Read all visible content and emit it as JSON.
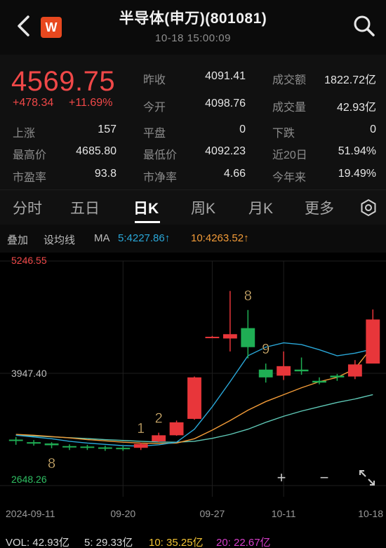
{
  "header": {
    "title": "半导体(申万)(801081)",
    "subtitle": "10-18 15:00:09",
    "logo_text": "W",
    "back_icon": "back-chevron-icon",
    "search_icon": "search-icon"
  },
  "quote": {
    "price": "4569.75",
    "change": "+478.34",
    "change_pct": "+11.69%",
    "rows": [
      [
        {
          "l": "昨收",
          "v": "4091.41"
        },
        {
          "l": "成交额",
          "v": "1822.72亿"
        }
      ],
      [
        {
          "l": "今开",
          "v": "4098.76"
        },
        {
          "l": "成交量",
          "v": "42.93亿"
        }
      ]
    ],
    "grid": [
      [
        {
          "l": "上涨",
          "v": "157"
        },
        {
          "l": "平盘",
          "v": "0"
        },
        {
          "l": "下跌",
          "v": "0"
        }
      ],
      [
        {
          "l": "最高价",
          "v": "4685.80"
        },
        {
          "l": "最低价",
          "v": "4092.23"
        },
        {
          "l": "近20日",
          "v": "51.94%"
        }
      ],
      [
        {
          "l": "市盈率",
          "v": "93.8"
        },
        {
          "l": "市净率",
          "v": "4.66"
        },
        {
          "l": "今年来",
          "v": "19.49%"
        }
      ]
    ]
  },
  "tabs": [
    "分时",
    "五日",
    "日K",
    "周K",
    "月K",
    "更多"
  ],
  "active_tab": "日K",
  "indicators": {
    "overlay": "叠加",
    "ma_setting": "设均线",
    "ma": "MA",
    "ma5": "5:4227.86↑",
    "ma10": "10:4263.52↑"
  },
  "colors": {
    "up": "#e8363a",
    "down": "#1fae54",
    "ma5": "#2aa7d8",
    "ma10": "#f29b38",
    "ma20": "#5fc9b7",
    "ma20_vol": "#d63ec9"
  },
  "chart_data": {
    "type": "candlestick",
    "y_max_label": "5246.55",
    "y_mid_label": "3947.40",
    "y_min_label": "2648.26",
    "ylim": [
      2648.26,
      5246.55
    ],
    "x_ticks": [
      {
        "label": "2024-09-11",
        "index": 0
      },
      {
        "label": "09-20",
        "index": 6
      },
      {
        "label": "09-27",
        "index": 11
      },
      {
        "label": "10-11",
        "index": 15
      },
      {
        "label": "10-18",
        "index": 20
      }
    ],
    "candles": [
      {
        "o": 3180,
        "c": 3165,
        "h": 3210,
        "l": 3120
      },
      {
        "o": 3150,
        "c": 3140,
        "h": 3175,
        "l": 3110
      },
      {
        "o": 3135,
        "c": 3115,
        "h": 3150,
        "l": 3080
      },
      {
        "o": 3105,
        "c": 3100,
        "h": 3125,
        "l": 3060
      },
      {
        "o": 3100,
        "c": 3095,
        "h": 3120,
        "l": 3060
      },
      {
        "o": 3090,
        "c": 3085,
        "h": 3110,
        "l": 3050
      },
      {
        "o": 3085,
        "c": 3080,
        "h": 3105,
        "l": 3050
      },
      {
        "o": 3085,
        "c": 3130,
        "h": 3145,
        "l": 3060
      },
      {
        "o": 3160,
        "c": 3230,
        "h": 3260,
        "l": 3150
      },
      {
        "o": 3230,
        "c": 3380,
        "h": 3400,
        "l": 3225
      },
      {
        "o": 3420,
        "c": 3900,
        "h": 3910,
        "l": 3410
      },
      {
        "o": 4370,
        "c": 4370,
        "h": 4380,
        "l": 4360
      },
      {
        "o": 4350,
        "c": 4400,
        "h": 4900,
        "l": 4200
      },
      {
        "o": 4470,
        "c": 4250,
        "h": 4680,
        "l": 4120
      },
      {
        "o": 3990,
        "c": 3900,
        "h": 4060,
        "l": 3840
      },
      {
        "o": 3920,
        "c": 4030,
        "h": 4200,
        "l": 3870
      },
      {
        "o": 3990,
        "c": 3970,
        "h": 4130,
        "l": 3930
      },
      {
        "o": 3860,
        "c": 3840,
        "h": 3900,
        "l": 3820
      },
      {
        "o": 3920,
        "c": 3900,
        "h": 3940,
        "l": 3860
      },
      {
        "o": 3910,
        "c": 4050,
        "h": 4100,
        "l": 3880
      },
      {
        "o": 4060,
        "c": 4570,
        "h": 4685.8,
        "l": 4092.23
      }
    ],
    "ma5": [
      3230,
      3210,
      3190,
      3160,
      3140,
      3125,
      3110,
      3105,
      3120,
      3150,
      3300,
      3560,
      3850,
      4150,
      4250,
      4300,
      4280,
      4220,
      4150,
      4180,
      4227.86
    ],
    "ma10": [
      3240,
      3230,
      3215,
      3200,
      3180,
      3165,
      3150,
      3140,
      3135,
      3140,
      3190,
      3290,
      3400,
      3520,
      3620,
      3700,
      3780,
      3850,
      3900,
      4000,
      4263.52
    ],
    "ma20": [
      3230,
      3222,
      3212,
      3202,
      3192,
      3180,
      3170,
      3160,
      3152,
      3150,
      3160,
      3195,
      3240,
      3300,
      3380,
      3450,
      3510,
      3560,
      3610,
      3650,
      3700
    ],
    "markers": [
      {
        "text": "8",
        "index": 2,
        "pos": "below"
      },
      {
        "text": "1",
        "index": 7,
        "pos": "above"
      },
      {
        "text": "2",
        "index": 8,
        "pos": "above"
      },
      {
        "text": "8",
        "index": 13,
        "pos": "above"
      },
      {
        "text": "9",
        "index": 14,
        "pos": "above"
      }
    ]
  },
  "volume": {
    "vol": "VOL: 42.93亿",
    "v5": "5: 29.33亿",
    "v10": "10: 35.25亿",
    "v20": "20: 22.67亿"
  },
  "controls": {
    "zoom_in": "+",
    "zoom_out": "−",
    "expand_icon": "expand-icon",
    "settings_icon": "gear-icon"
  }
}
